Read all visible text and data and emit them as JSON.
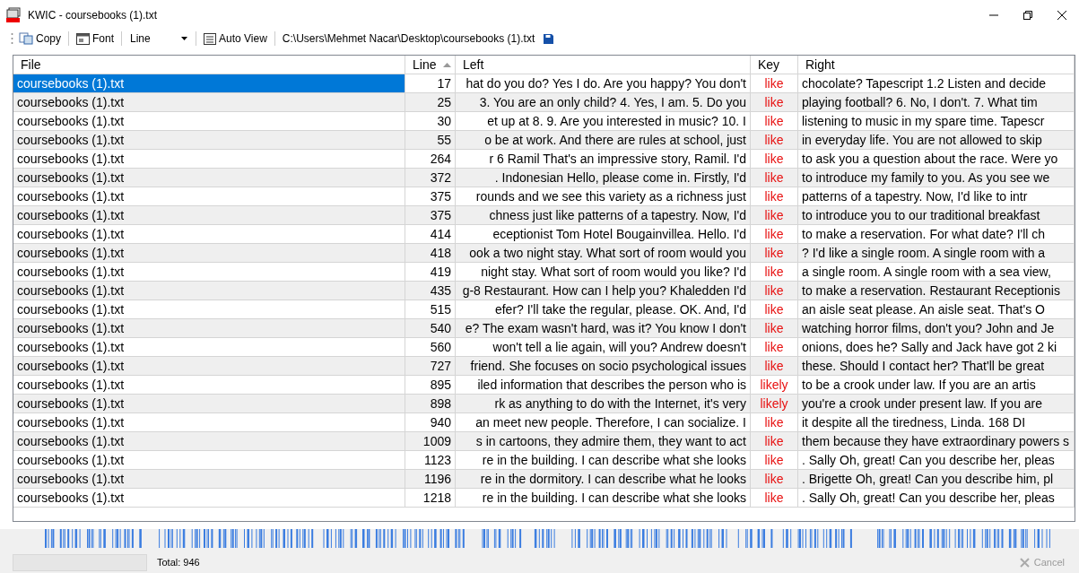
{
  "window": {
    "title": "KWIC - coursebooks (1).txt"
  },
  "toolbar": {
    "copy": "Copy",
    "font": "Font",
    "view_dropdown": "Line",
    "auto_view": "Auto View",
    "path": "C:\\Users\\Mehmet Nacar\\Desktop\\coursebooks (1).txt"
  },
  "table": {
    "columns": [
      {
        "label": "File",
        "sorted": false
      },
      {
        "label": "Line",
        "sorted": true
      },
      {
        "label": "Left",
        "sorted": false
      },
      {
        "label": "Key",
        "sorted": false
      },
      {
        "label": "Right",
        "sorted": false
      }
    ],
    "rows": [
      {
        "file": "coursebooks (1).txt",
        "line": "17",
        "left": "hat do you do? Yes I do. Are you happy? You don't",
        "key": "like",
        "right": "chocolate?  Tapescript 1.2 Listen and decide",
        "selected": true
      },
      {
        "file": "coursebooks (1).txt",
        "line": "25",
        "left": "3. You are an only child? 4. Yes, I am. 5. Do you",
        "key": "like",
        "right": "playing football? 6. No, I don't. 7. What tim",
        "selected": false
      },
      {
        "file": "coursebooks (1).txt",
        "line": "30",
        "left": "et up at 8. 9. Are you interested in music? 10. I",
        "key": "like",
        "right": "listening to music in my spare time.  Tapescr",
        "selected": false
      },
      {
        "file": "coursebooks (1).txt",
        "line": "55",
        "left": "o be at work. And there are rules at school, just",
        "key": "like",
        "right": "in everyday life. You are not allowed to skip",
        "selected": false
      },
      {
        "file": "coursebooks (1).txt",
        "line": "264",
        "left": "r 6 Ramil  That's an impressive story, Ramil. I'd",
        "key": "like",
        "right": "to ask you a question about the race. Were yo",
        "selected": false
      },
      {
        "file": "coursebooks (1).txt",
        "line": "372",
        "left": ".  Indonesian Hello, please come in. Firstly, I'd",
        "key": "like",
        "right": "to introduce my family to you. As you see we",
        "selected": false
      },
      {
        "file": "coursebooks (1).txt",
        "line": "375",
        "left": "rounds and we see this variety as a richness just",
        "key": "like",
        "right": "patterns of a tapestry. Now, I'd like to intr",
        "selected": false
      },
      {
        "file": "coursebooks (1).txt",
        "line": "375",
        "left": "chness just like patterns of a tapestry. Now, I'd",
        "key": "like",
        "right": "to introduce you to our traditional breakfast",
        "selected": false
      },
      {
        "file": "coursebooks (1).txt",
        "line": "414",
        "left": "eceptionist  Tom  Hotel Bougainvillea. Hello. I'd",
        "key": "like",
        "right": "to make a reservation. For what date? I'll ch",
        "selected": false
      },
      {
        "file": "coursebooks (1).txt",
        "line": "418",
        "left": "ook a two night stay. What sort of room would you",
        "key": "like",
        "right": "? I'd like a single room. A single room with a",
        "selected": false
      },
      {
        "file": "coursebooks (1).txt",
        "line": "419",
        "left": "night stay. What sort of room would you like? I'd",
        "key": "like",
        "right": "a single room. A single room with a sea view,",
        "selected": false
      },
      {
        "file": "coursebooks (1).txt",
        "line": "435",
        "left": "g-8 Restaurant. How can I help you? Khaledden I'd",
        "key": "like",
        "right": "to make a reservation. Restaurant Receptionis",
        "selected": false
      },
      {
        "file": "coursebooks (1).txt",
        "line": "515",
        "left": "efer? I'll take the regular, please. OK. And, I'd",
        "key": "like",
        "right": "an aisle seat please. An aisle seat. That's O",
        "selected": false
      },
      {
        "file": "coursebooks (1).txt",
        "line": "540",
        "left": "e? The exam wasn't hard, was it? You know I don't",
        "key": "like",
        "right": "watching horror films, don't you? John and Je",
        "selected": false
      },
      {
        "file": "coursebooks (1).txt",
        "line": "560",
        "left": "won't tell a lie again, will you? Andrew doesn't",
        "key": "like",
        "right": "onions, does he? Sally and Jack have got 2 ki",
        "selected": false
      },
      {
        "file": "coursebooks (1).txt",
        "line": "727",
        "left": "friend. She focuses on socio psychological issues",
        "key": "like",
        "right": "these. Should I contact her? That'll be great",
        "selected": false
      },
      {
        "file": "coursebooks (1).txt",
        "line": "895",
        "left": "iled information that describes the person who is",
        "key": "likely",
        "right": "to be a crook under law.  If you are an artis",
        "selected": false
      },
      {
        "file": "coursebooks (1).txt",
        "line": "898",
        "left": "rk as anything to do with the Internet, it's very",
        "key": "likely",
        "right": "you're a crook under present law. If you are",
        "selected": false
      },
      {
        "file": "coursebooks (1).txt",
        "line": "940",
        "left": "an meet new people. Therefore, I can socialize. I",
        "key": "like",
        "right": "it despite all the tiredness, Linda.  168  DI",
        "selected": false
      },
      {
        "file": "coursebooks (1).txt",
        "line": "1009",
        "left": "s in cartoons, they admire them, they want to act",
        "key": "like",
        "right": "them because they have extraordinary powers s",
        "selected": false
      },
      {
        "file": "coursebooks (1).txt",
        "line": "1123",
        "left": "re in the building. I can describe what she looks",
        "key": "like",
        "right": ". Sally Oh, great! Can you describe her, pleas",
        "selected": false
      },
      {
        "file": "coursebooks (1).txt",
        "line": "1196",
        "left": "re in the dormitory. I can describe what he looks",
        "key": "like",
        "right": ". Brigette Oh, great! Can you describe him, pl",
        "selected": false
      },
      {
        "file": "coursebooks (1).txt",
        "line": "1218",
        "left": "re in the building. I can describe what she looks",
        "key": "like",
        "right": ". Sally Oh, great! Can you describe her, pleas",
        "selected": false
      }
    ]
  },
  "status_bar": {
    "total": "Total: 946",
    "cancel": "Cancel",
    "cancel_disabled": true
  }
}
